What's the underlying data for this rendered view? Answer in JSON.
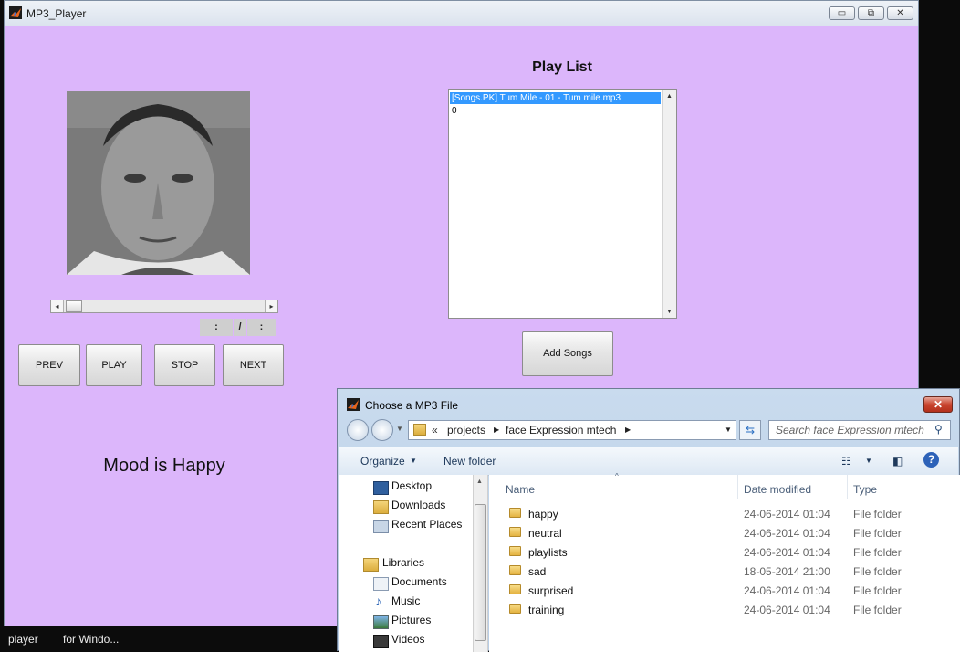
{
  "player_window": {
    "title": "MP3_Player",
    "caption_buttons": {
      "minimize": "▭",
      "maximize": "⧉",
      "close": "✕"
    },
    "time_display": {
      "current_sep": ":",
      "divider": "/",
      "total_sep": ":"
    },
    "buttons": {
      "prev": "PREV",
      "play": "PLAY",
      "stop": "STOP",
      "next": "NEXT"
    },
    "mood_text": "Mood is Happy",
    "playlist": {
      "title": "Play List",
      "items": [
        "[Songs.PK] Tum Mile - 01 - Tum mile.mp3",
        "0"
      ],
      "add_button": "Add Songs"
    },
    "colors": {
      "background": "#dcb6fb",
      "selection": "#3399ff"
    }
  },
  "file_dialog": {
    "title": "Choose a MP3 File",
    "address": {
      "prefix": "«",
      "parts": [
        "projects",
        "face Expression  mtech"
      ]
    },
    "search_placeholder": "Search face Expression  mtech",
    "toolbar": {
      "organize": "Organize",
      "new_folder": "New folder"
    },
    "nav_items": [
      "Desktop",
      "Downloads",
      "Recent Places",
      "Libraries",
      "Documents",
      "Music",
      "Pictures",
      "Videos"
    ],
    "columns": [
      "Name",
      "Date modified",
      "Type"
    ],
    "rows": [
      {
        "name": "happy",
        "date": "24-06-2014 01:04",
        "type": "File folder"
      },
      {
        "name": "neutral",
        "date": "24-06-2014 01:04",
        "type": "File folder"
      },
      {
        "name": "playlists",
        "date": "24-06-2014 01:04",
        "type": "File folder"
      },
      {
        "name": "sad",
        "date": "18-05-2014 21:00",
        "type": "File folder"
      },
      {
        "name": "surprised",
        "date": "24-06-2014 01:04",
        "type": "File folder"
      },
      {
        "name": "training",
        "date": "24-06-2014 01:04",
        "type": "File folder"
      }
    ]
  },
  "taskbar": {
    "items": [
      "player",
      "for Windo..."
    ]
  }
}
